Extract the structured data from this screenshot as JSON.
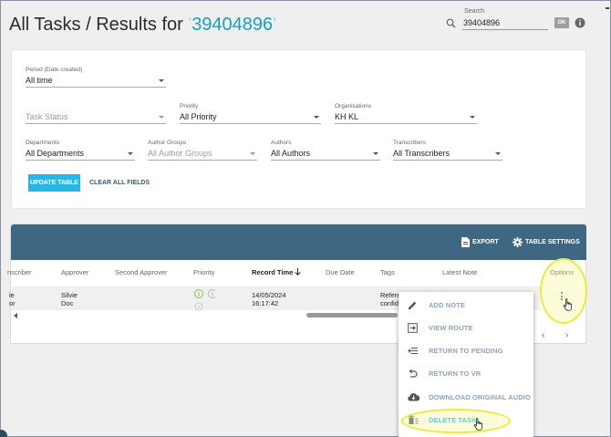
{
  "header": {
    "title": "All Tasks / Results for ",
    "query_open": "'",
    "query_value": "39404896",
    "query_close": "'",
    "search_label": "Search",
    "search_value": "39404896",
    "ok_label": "OK"
  },
  "filters": {
    "period": {
      "label": "Period (Date created)",
      "value": "All time"
    },
    "task_status": {
      "label": "",
      "placeholder": "Task Status"
    },
    "priority": {
      "label": "Priority",
      "value": "All Priority"
    },
    "organisations": {
      "label": "Organisations",
      "value": "KH KL"
    },
    "departments": {
      "label": "Departments",
      "value": "All Departments"
    },
    "author_groups": {
      "label": "Author Groups",
      "placeholder": "All Author Groups"
    },
    "authors": {
      "label": "Authors",
      "value": "All Authors"
    },
    "transcribers": {
      "label": "Transcribers",
      "value": "All Transcribers"
    },
    "update_label": "UPDATE TABLE",
    "clear_label": "CLEAR ALL FIELDS"
  },
  "toolbar": {
    "export_label": "EXPORT",
    "settings_label": "TABLE SETTINGS"
  },
  "table": {
    "columns": {
      "transcriber": "nscriber",
      "approver": "Approver",
      "second_approver": "Second Approver",
      "priority": "Priority",
      "record_time": "Record Time",
      "due_date": "Due Date",
      "tags": "Tags",
      "latest_note": "Latest Note",
      "options": "Options"
    },
    "row": {
      "transcriber_line1": "ie",
      "transcriber_line2": "or",
      "approver_line1": "Silvie",
      "approver_line2": "Doc",
      "record_date": "14/05/2024",
      "record_clock": "16:17:42",
      "tags_line1": "Referr",
      "tags_line2": "confid"
    },
    "pager_prev": "‹",
    "pager_next": "›"
  },
  "menu": {
    "items": [
      {
        "label": "ADD NOTE",
        "icon": "pencil-icon"
      },
      {
        "label": "VIEW ROUTE",
        "icon": "route-icon"
      },
      {
        "label": "RETURN TO PENDING",
        "icon": "return-pending-icon"
      },
      {
        "label": "RETURN TO VR",
        "icon": "undo-icon"
      },
      {
        "label": "DOWNLOAD ORIGINAL AUDIO",
        "icon": "cloud-download-icon"
      },
      {
        "label": "DELETE TASK",
        "icon": "trash-icon"
      }
    ]
  },
  "colors": {
    "accent": "#29b6e6",
    "toolbar": "#3f6782",
    "highlight": "#e8ec3a",
    "menu_text": "#90a4b8"
  }
}
